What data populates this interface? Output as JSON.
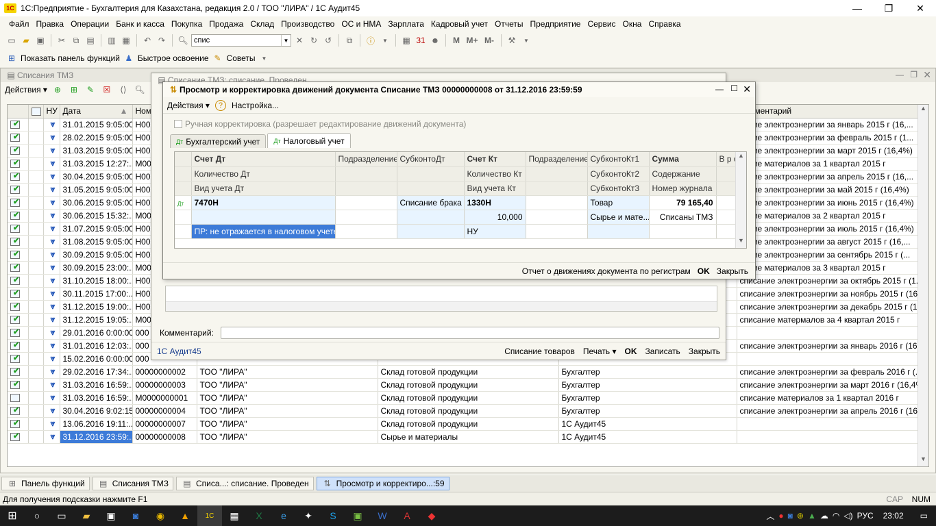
{
  "window": {
    "title": "1С:Предприятие - Бухгалтерия для Казахстана, редакция 2.0 / ТОО \"ЛИРА\" / 1С Аудит45",
    "logo": "1С"
  },
  "menu": [
    "Файл",
    "Правка",
    "Операции",
    "Банк и касса",
    "Покупка",
    "Продажа",
    "Склад",
    "Производство",
    "ОС и НМА",
    "Зарплата",
    "Кадровый учет",
    "Отчеты",
    "Предприятие",
    "Сервис",
    "Окна",
    "Справка"
  ],
  "toolbar": {
    "search_value": "спис",
    "m_buttons": [
      "М",
      "М+",
      "М-"
    ]
  },
  "toolbar2": {
    "show_panel": "Показать панель функций",
    "quick": "Быстрое освоение",
    "tips": "Советы"
  },
  "main_window": {
    "title": "Списания ТМЗ",
    "actions_label": "Действия",
    "columns": [
      "",
      "НУ",
      "Дата",
      "Ном",
      "",
      "",
      "",
      "Комментарий"
    ],
    "rows": [
      {
        "date": "31.01.2015 9:05:00",
        "num": "Н00",
        "comment": "сание электроэнергии за январь 2015 г (16,..."
      },
      {
        "date": "28.02.2015 9:05:00",
        "num": "Н00",
        "comment": "сание электроэнергии за февраль 2015 г (1..."
      },
      {
        "date": "31.03.2015 9:05:00",
        "num": "Н00",
        "comment": "сание электроэнергии за март 2015 г (16,4%)"
      },
      {
        "date": "31.03.2015 12:27:...",
        "num": "М00",
        "comment": "сание материалов за 1 квартал 2015 г"
      },
      {
        "date": "30.04.2015 9:05:00",
        "num": "Н00",
        "comment": "сание электроэнергии за апрель 2015 г (16,..."
      },
      {
        "date": "31.05.2015 9:05:00",
        "num": "Н00",
        "comment": "сание электроэнергии за май 2015 г (16,4%)"
      },
      {
        "date": "30.06.2015 9:05:00",
        "num": "Н00",
        "comment": "сание электроэнергии за июнь 2015 г (16,4%)"
      },
      {
        "date": "30.06.2015 15:32:...",
        "num": "М00",
        "comment": "сание материалов за 2 квартал 2015 г"
      },
      {
        "date": "31.07.2015 9:05:00",
        "num": "Н00",
        "comment": "сание электроэнергии за июль 2015 г (16,4%)"
      },
      {
        "date": "31.08.2015 9:05:00",
        "num": "Н00",
        "comment": "сание электроэнергии за август 2015 г (16,..."
      },
      {
        "date": "30.09.2015 9:05:00",
        "num": "Н00",
        "comment": "сание электроэнергии за сентябрь 2015 г (..."
      },
      {
        "date": "30.09.2015 23:00:...",
        "num": "М00",
        "comment": "сание материалов за 3 квартал 2015 г"
      },
      {
        "date": "31.10.2015 18:00:...",
        "num": "Н00",
        "comment": "списание электроэнергии за октябрь 2015 г (1..."
      },
      {
        "date": "30.11.2015 17:00:...",
        "num": "Н00",
        "comment": "списание электроэнергии за ноябрь 2015 г (16,..."
      },
      {
        "date": "31.12.2015 19:00:...",
        "num": "Н00",
        "comment": "списание электроэнергии за декабрь 2015 г (16,..."
      },
      {
        "date": "31.12.2015 19:05:...",
        "num": "М00",
        "comment": "списание матермалов за 4 квартал 2015 г"
      },
      {
        "date": "29.01.2016 0:00:00",
        "num": "000",
        "comment": ""
      },
      {
        "date": "31.01.2016 12:03:...",
        "num": "000",
        "comment": "списание электроэнергии за январь 2016 г (16,..."
      },
      {
        "date": "15.02.2016 0:00:00",
        "num": "000",
        "comment": ""
      },
      {
        "date": "29.02.2016 17:34:...",
        "num": "00000000002",
        "org": "ТОО \"ЛИРА\"",
        "warehouse": "Склад готовой продукции",
        "resp": "Бухгалтер",
        "comment": "списание электроэнергии за февраль  2016 г (..."
      },
      {
        "date": "31.03.2016 16:59:...",
        "num": "00000000003",
        "org": "ТОО \"ЛИРА\"",
        "warehouse": "Склад готовой продукции",
        "resp": "Бухгалтер",
        "comment": "списание электроэнергии за март  2016 г (16,4%)"
      },
      {
        "date": "31.03.2016 16:59:...",
        "num": "М0000000001",
        "org": "ТОО \"ЛИРА\"",
        "warehouse": "Склад готовой продукции",
        "resp": "Бухгалтер",
        "comment": "списание материалов за 1 квартал 2016 г"
      },
      {
        "date": "30.04.2016 9:02:15",
        "num": "00000000004",
        "org": "ТОО \"ЛИРА\"",
        "warehouse": "Склад готовой продукции",
        "resp": "Бухгалтер",
        "comment": "списание электроэнергии за апрель  2016 г (16..."
      },
      {
        "date": "13.06.2016 19:11:...",
        "num": "00000000007",
        "org": "ТОО \"ЛИРА\"",
        "warehouse": "Склад готовой продукции",
        "resp": "1С Аудит45",
        "comment": ""
      },
      {
        "date": "31.12.2016 23:59:...",
        "num": "00000000008",
        "org": "ТОО \"ЛИРА\"",
        "warehouse": "Сырье и материалы",
        "resp": "1С Аудит45",
        "comment": ""
      }
    ]
  },
  "doc_window": {
    "title": "Списание ТМЗ: списание. Проведен",
    "comment_label": "Комментарий:",
    "author": "1С Аудит45",
    "btn_write_off": "Списание товаров",
    "btn_print": "Печать",
    "btn_ok": "OK",
    "btn_save": "Записать",
    "btn_close": "Закрыть"
  },
  "dialog": {
    "title": "Просмотр и корректировка движений документа Списание ТМЗ 00000000008 от 31.12.2016 23:59:59",
    "actions": "Действия",
    "settings": "Настройка...",
    "manual_label": "Ручная корректировка (разрешает редактирование движений документа)",
    "tabs": [
      "Бухгалтерский учет",
      "Налоговый учет"
    ],
    "header": {
      "r1": [
        "Счет Дт",
        "Подразделение Дт",
        "СубконтоДт",
        "Счет Кт",
        "Подразделение Кт",
        "СубконтоКт1",
        "Сумма",
        "В р о"
      ],
      "r2": [
        "Количество Дт",
        "",
        "",
        "Количество Кт",
        "",
        "СубконтоКт2",
        "Содержание",
        ""
      ],
      "r3": [
        "Вид учета Дт",
        "",
        "",
        "Вид учета Кт",
        "",
        "СубконтоКт3",
        "Номер журнала",
        ""
      ]
    },
    "row": {
      "r1": [
        "7470Н",
        "",
        "Списание брака",
        "1330Н",
        "",
        "Товар",
        "79 165,40",
        ""
      ],
      "r2": [
        "",
        "",
        "",
        "10,000",
        "",
        "Сырье и мате...",
        "Списаны ТМЗ",
        ""
      ],
      "r3": [
        "ПР: не отражается в налоговом учете",
        "",
        "",
        "НУ",
        "",
        "",
        "",
        ""
      ]
    },
    "report_link": "Отчет о движениях документа по регистрам",
    "ok": "OK",
    "close": "Закрыть"
  },
  "taskbar_tabs": [
    "Панель функций",
    "Списания ТМЗ",
    "Списа...: списание. Проведен",
    "Просмотр и корректиро...:59"
  ],
  "status": {
    "hint": "Для получения подсказки нажмите F1",
    "cap": "CAP",
    "num": "NUM"
  },
  "winbar": {
    "lang": "РУС",
    "time": "23:02"
  }
}
